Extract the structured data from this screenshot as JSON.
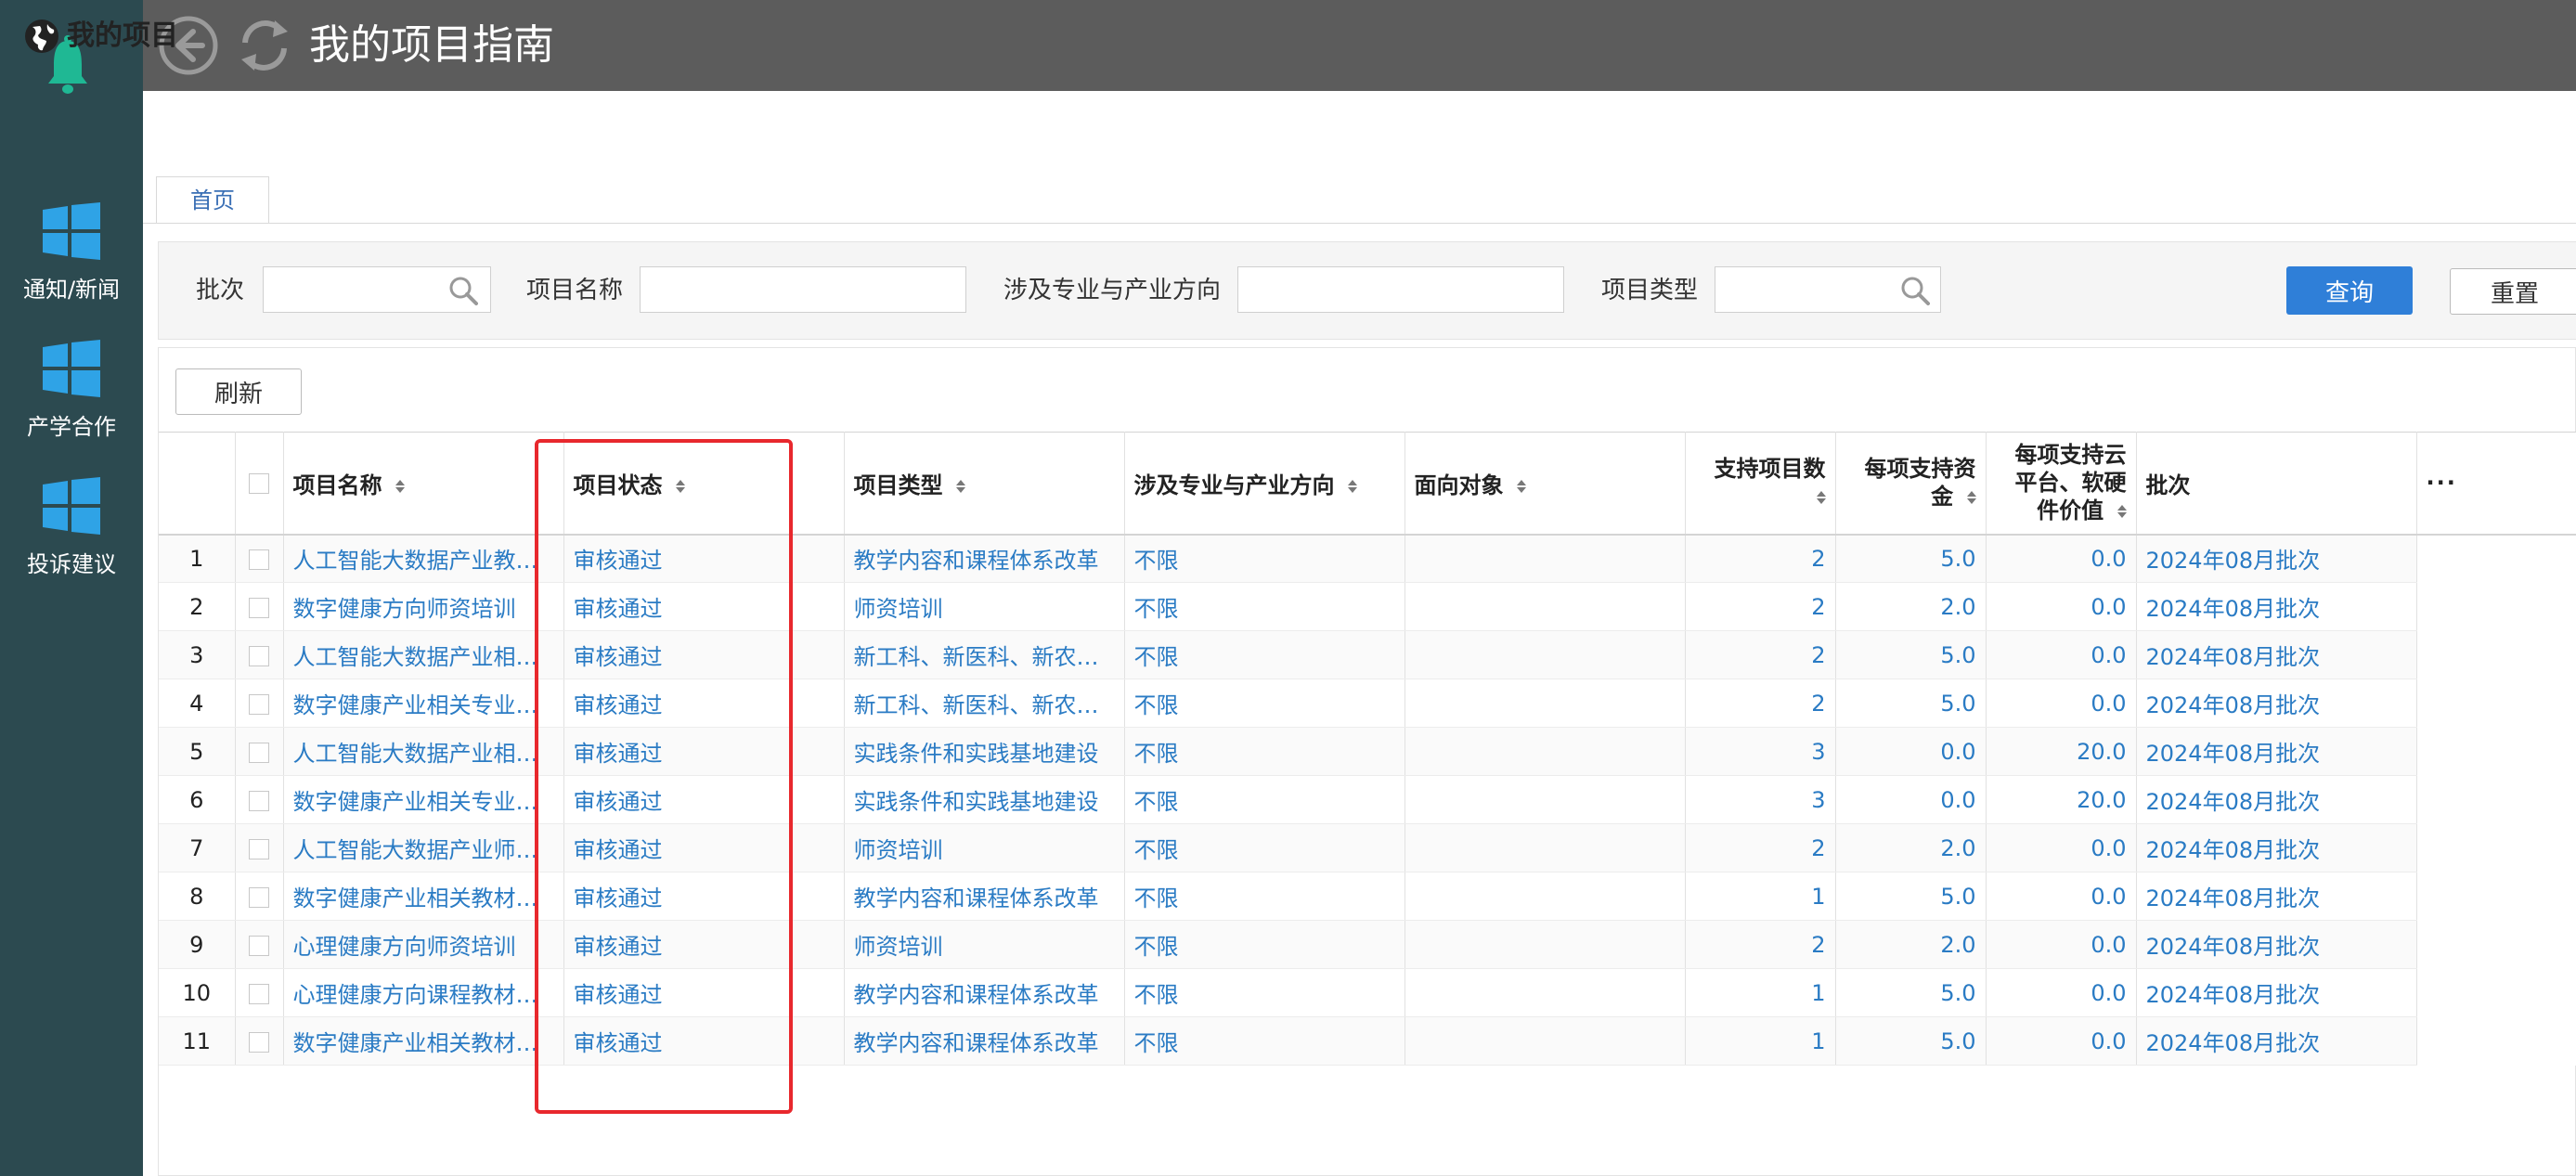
{
  "sidebar": {
    "items": [
      {
        "label": "通知/新闻",
        "icon": "windows-icon"
      },
      {
        "label": "产学合作",
        "icon": "windows-icon"
      },
      {
        "label": "投诉建议",
        "icon": "windows-icon"
      }
    ]
  },
  "header": {
    "title": "我的项目指南"
  },
  "subheader": {
    "title": "我的项目"
  },
  "tabs": [
    {
      "label": "首页"
    }
  ],
  "filters": {
    "batch_label": "批次",
    "batch_value": "",
    "name_label": "项目名称",
    "name_value": "",
    "major_label": "涉及专业与产业方向",
    "major_value": "",
    "type_label": "项目类型",
    "type_value": "",
    "query_label": "查询",
    "reset_label": "重置"
  },
  "toolbar": {
    "refresh_label": "刷新"
  },
  "table": {
    "columns": {
      "name": "项目名称",
      "status": "项目状态",
      "type": "项目类型",
      "major": "涉及专业与产业方向",
      "target": "面向对象",
      "count": "支持项目数",
      "funding": "每项支持资金",
      "cloud": "每项支持云平台、软硬件价值",
      "batch": "批次",
      "more": "···"
    },
    "rows": [
      {
        "idx": "1",
        "name": "人工智能大数据产业教材建设",
        "status": "审核通过",
        "type": "教学内容和课程体系改革",
        "major": "不限",
        "target": "",
        "count": "2",
        "funding": "5.0",
        "cloud": "0.0",
        "batch": "2024年08月批次"
      },
      {
        "idx": "2",
        "name": "数字健康方向师资培训",
        "status": "审核通过",
        "type": "师资培训",
        "major": "不限",
        "target": "",
        "count": "2",
        "funding": "2.0",
        "cloud": "0.0",
        "batch": "2024年08月批次"
      },
      {
        "idx": "3",
        "name": "人工智能大数据产业相关专业建设",
        "status": "审核通过",
        "type": "新工科、新医科、新农科、新文科建设",
        "major": "不限",
        "target": "",
        "count": "2",
        "funding": "5.0",
        "cloud": "0.0",
        "batch": "2024年08月批次"
      },
      {
        "idx": "4",
        "name": "数字健康产业相关专业建设",
        "status": "审核通过",
        "type": "新工科、新医科、新农科、新文科建设",
        "major": "不限",
        "target": "",
        "count": "2",
        "funding": "5.0",
        "cloud": "0.0",
        "batch": "2024年08月批次"
      },
      {
        "idx": "5",
        "name": "人工智能大数据产业相关实践基地建设",
        "status": "审核通过",
        "type": "实践条件和实践基地建设",
        "major": "不限",
        "target": "",
        "count": "3",
        "funding": "0.0",
        "cloud": "20.0",
        "batch": "2024年08月批次"
      },
      {
        "idx": "6",
        "name": "数字健康产业相关专业实践基地建设",
        "status": "审核通过",
        "type": "实践条件和实践基地建设",
        "major": "不限",
        "target": "",
        "count": "3",
        "funding": "0.0",
        "cloud": "20.0",
        "batch": "2024年08月批次"
      },
      {
        "idx": "7",
        "name": "人工智能大数据产业师资培训",
        "status": "审核通过",
        "type": "师资培训",
        "major": "不限",
        "target": "",
        "count": "2",
        "funding": "2.0",
        "cloud": "0.0",
        "batch": "2024年08月批次"
      },
      {
        "idx": "8",
        "name": "数字健康产业相关教材建设",
        "status": "审核通过",
        "type": "教学内容和课程体系改革",
        "major": "不限",
        "target": "",
        "count": "1",
        "funding": "5.0",
        "cloud": "0.0",
        "batch": "2024年08月批次"
      },
      {
        "idx": "9",
        "name": "心理健康方向师资培训",
        "status": "审核通过",
        "type": "师资培训",
        "major": "不限",
        "target": "",
        "count": "2",
        "funding": "2.0",
        "cloud": "0.0",
        "batch": "2024年08月批次"
      },
      {
        "idx": "10",
        "name": "心理健康方向课程教材建设",
        "status": "审核通过",
        "type": "教学内容和课程体系改革",
        "major": "不限",
        "target": "",
        "count": "1",
        "funding": "5.0",
        "cloud": "0.0",
        "batch": "2024年08月批次"
      },
      {
        "idx": "11",
        "name": "数字健康产业相关教材建设",
        "status": "审核通过",
        "type": "教学内容和课程体系改革",
        "major": "不限",
        "target": "",
        "count": "1",
        "funding": "5.0",
        "cloud": "0.0",
        "batch": "2024年08月批次"
      }
    ]
  },
  "colors": {
    "sidebar": "#2c4a50",
    "topbar": "#5c5c5c",
    "accent": "#2f7fd8",
    "link": "#2a7bc4",
    "highlight": "#e8282d",
    "bell": "#1fb894"
  }
}
